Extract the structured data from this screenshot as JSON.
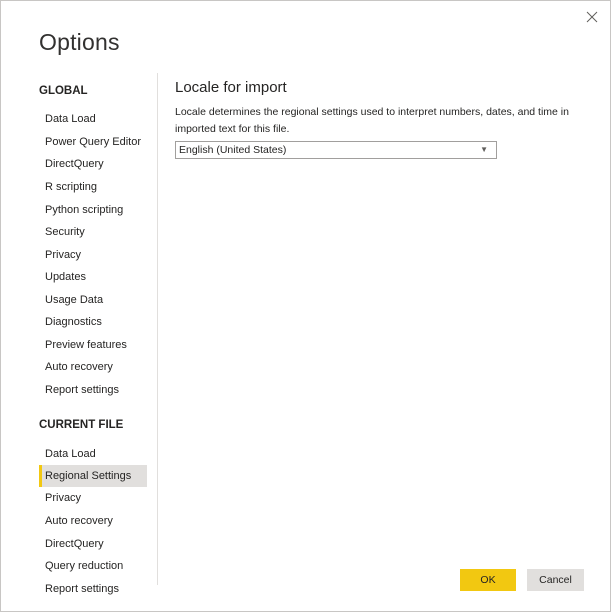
{
  "dialog": {
    "title": "Options",
    "close_icon": "close-icon"
  },
  "sidebar": {
    "global_header": "GLOBAL",
    "global_items": [
      {
        "label": "Data Load"
      },
      {
        "label": "Power Query Editor"
      },
      {
        "label": "DirectQuery"
      },
      {
        "label": "R scripting"
      },
      {
        "label": "Python scripting"
      },
      {
        "label": "Security"
      },
      {
        "label": "Privacy"
      },
      {
        "label": "Updates"
      },
      {
        "label": "Usage Data"
      },
      {
        "label": "Diagnostics"
      },
      {
        "label": "Preview features"
      },
      {
        "label": "Auto recovery"
      },
      {
        "label": "Report settings"
      }
    ],
    "current_file_header": "CURRENT FILE",
    "current_file_items": [
      {
        "label": "Data Load"
      },
      {
        "label": "Regional Settings",
        "selected": true
      },
      {
        "label": "Privacy"
      },
      {
        "label": "Auto recovery"
      },
      {
        "label": "DirectQuery"
      },
      {
        "label": "Query reduction"
      },
      {
        "label": "Report settings"
      }
    ]
  },
  "main": {
    "heading": "Locale for import",
    "description": "Locale determines the regional settings used to interpret numbers, dates, and time in imported text for this file.",
    "locale_select": {
      "value": "English (United States)",
      "caret_icon": "chevron-down-icon"
    }
  },
  "footer": {
    "ok_label": "OK",
    "cancel_label": "Cancel"
  },
  "colors": {
    "accent": "#f2c811",
    "selected_bg": "#e1dfdd",
    "cancel_bg": "#e1dfdd",
    "text": "#252423"
  }
}
